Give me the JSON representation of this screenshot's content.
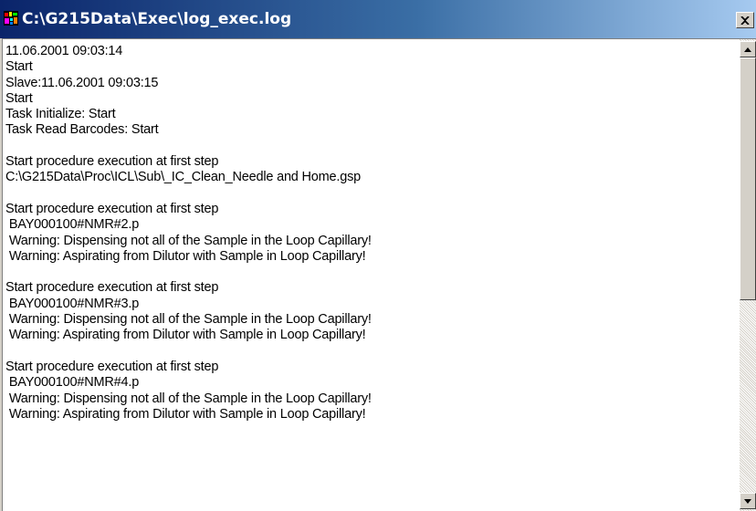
{
  "window": {
    "title": "C:\\G215Data\\Exec\\log_exec.log",
    "icon": "app-icon"
  },
  "log": {
    "lines": [
      "11.06.2001 09:03:14",
      "Start",
      "Slave:11.06.2001 09:03:15",
      "Start",
      "Task Initialize: Start",
      "Task Read Barcodes: Start",
      "",
      "Start procedure execution at first step",
      "C:\\G215Data\\Proc\\ICL\\Sub\\_IC_Clean_Needle and Home.gsp",
      "",
      "Start procedure execution at first step",
      " BAY000100#NMR#2.p",
      " Warning: Dispensing not all of the Sample in the Loop Capillary!",
      " Warning: Aspirating from Dilutor with Sample in Loop Capillary!",
      "",
      "Start procedure execution at first step",
      " BAY000100#NMR#3.p",
      " Warning: Dispensing not all of the Sample in the Loop Capillary!",
      " Warning: Aspirating from Dilutor with Sample in Loop Capillary!",
      "",
      "Start procedure execution at first step",
      " BAY000100#NMR#4.p",
      " Warning: Dispensing not all of the Sample in the Loop Capillary!",
      " Warning: Aspirating from Dilutor with Sample in Loop Capillary!"
    ]
  },
  "scrollbar": {
    "up_icon": "arrow-up-icon",
    "down_icon": "arrow-down-icon"
  }
}
